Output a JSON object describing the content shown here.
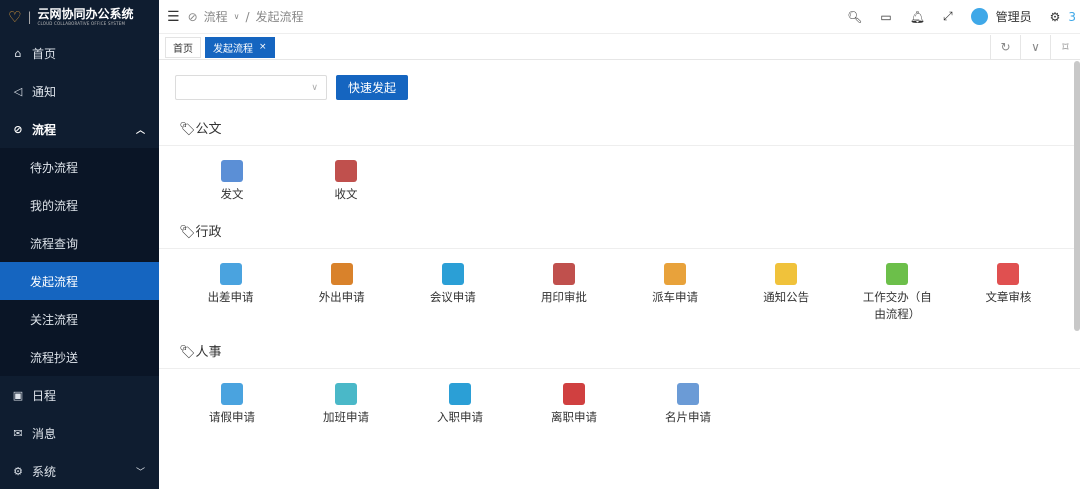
{
  "app": {
    "title": "云网协同办公系统",
    "subtitle": "CLOUD COLLABORATIVE OFFICE SYSTEM"
  },
  "sidebar": {
    "items": [
      {
        "label": "首页",
        "icon": "home-icon"
      },
      {
        "label": "通知",
        "icon": "megaphone-icon"
      },
      {
        "label": "流程",
        "icon": "check-circle-icon",
        "expanded": true,
        "children": [
          {
            "label": "待办流程"
          },
          {
            "label": "我的流程"
          },
          {
            "label": "流程查询"
          },
          {
            "label": "发起流程",
            "active": true
          },
          {
            "label": "关注流程"
          },
          {
            "label": "流程抄送"
          }
        ]
      },
      {
        "label": "日程",
        "icon": "calendar-icon"
      },
      {
        "label": "消息",
        "icon": "mail-icon"
      },
      {
        "label": "系统",
        "icon": "gear-icon"
      }
    ]
  },
  "header": {
    "breadcrumb": [
      "流程",
      "发起流程"
    ],
    "user": "管理员",
    "badge": "3"
  },
  "tabs": [
    {
      "label": "首页"
    },
    {
      "label": "发起流程",
      "active": true,
      "close": "×"
    }
  ],
  "main": {
    "select_value": "",
    "quick_button": "快速发起",
    "sections": [
      {
        "title": "公文",
        "items": [
          {
            "label": "发文",
            "color": "#5b8fd6"
          },
          {
            "label": "收文",
            "color": "#c0504d"
          }
        ]
      },
      {
        "title": "行政",
        "items": [
          {
            "label": "出差申请",
            "color": "#4aa3df"
          },
          {
            "label": "外出申请",
            "color": "#d9822b"
          },
          {
            "label": "会议申请",
            "color": "#2b9fd6"
          },
          {
            "label": "用印审批",
            "color": "#c0504d"
          },
          {
            "label": "派车申请",
            "color": "#e8a23b"
          },
          {
            "label": "通知公告",
            "color": "#f0c23b"
          },
          {
            "label": "工作交办（自由流程）",
            "color": "#6cbf4a"
          },
          {
            "label": "文章审核",
            "color": "#e05050"
          }
        ]
      },
      {
        "title": "人事",
        "items": [
          {
            "label": "请假申请",
            "color": "#4aa3df"
          },
          {
            "label": "加班申请",
            "color": "#4ab8c8"
          },
          {
            "label": "入职申请",
            "color": "#2b9fd6"
          },
          {
            "label": "离职申请",
            "color": "#d04040"
          },
          {
            "label": "名片申请",
            "color": "#6b9bd6"
          }
        ]
      }
    ]
  }
}
